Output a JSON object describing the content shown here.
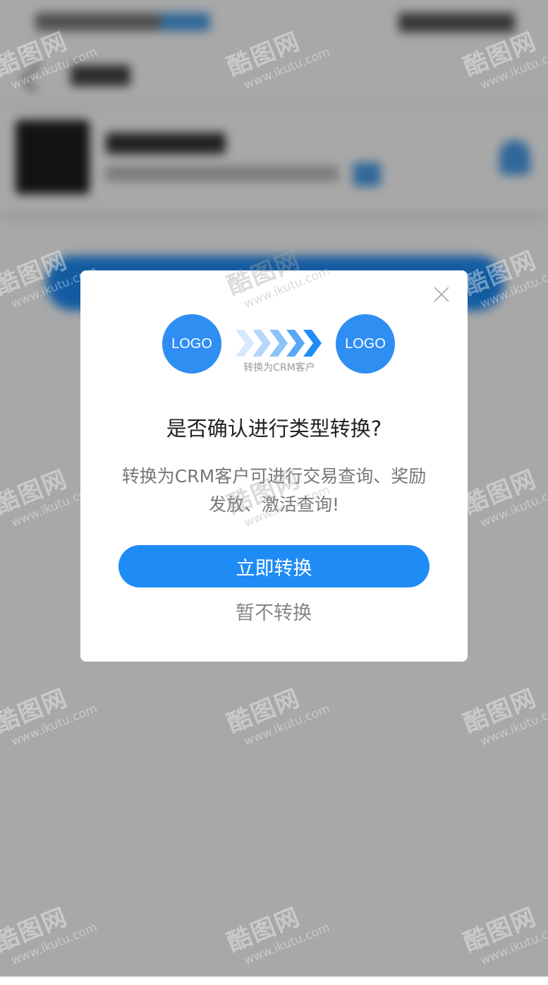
{
  "dialog": {
    "source_logo": "LOGO",
    "target_logo": "LOGO",
    "arrow_caption": "转换为CRM客户",
    "title": "是否确认进行类型转换?",
    "message": "转换为CRM客户可进行交易查询、奖励发放、激活查询!",
    "confirm_label": "立即转换",
    "cancel_label": "暂不转换",
    "close_icon": "close-icon"
  },
  "watermark": {
    "text": "酷图网",
    "url": "www.ikutu.com"
  },
  "colors": {
    "accent": "#1f8cf5",
    "logo_bg": "#2f8ef2",
    "title": "#222222",
    "message": "#777777",
    "cancel": "#888888",
    "overlay": "rgba(0,0,0,0.34)"
  }
}
